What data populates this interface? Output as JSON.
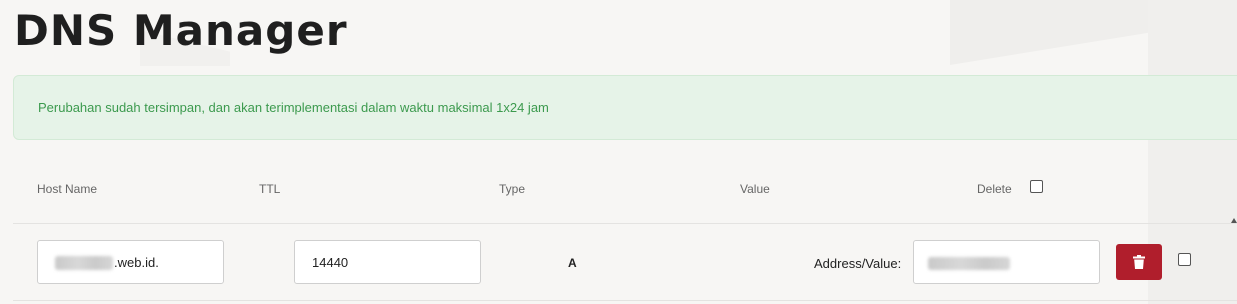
{
  "page": {
    "title": "DNS Manager"
  },
  "alert": {
    "message": "Perubahan sudah tersimpan, dan akan terimplementasi dalam waktu maksimal 1x24 jam"
  },
  "table": {
    "headers": {
      "host": "Host Name",
      "ttl": "TTL",
      "type": "Type",
      "value": "Value",
      "delete": "Delete"
    },
    "rows": [
      {
        "host_suffix": ".web.id.",
        "ttl": "14440",
        "type": "A",
        "value_label": "Address/Value:",
        "delete_icon": "trash-icon"
      }
    ]
  },
  "colors": {
    "alert_bg": "#e6f3e8",
    "alert_text": "#3c9a4e",
    "delete_button": "#b01e2c"
  }
}
